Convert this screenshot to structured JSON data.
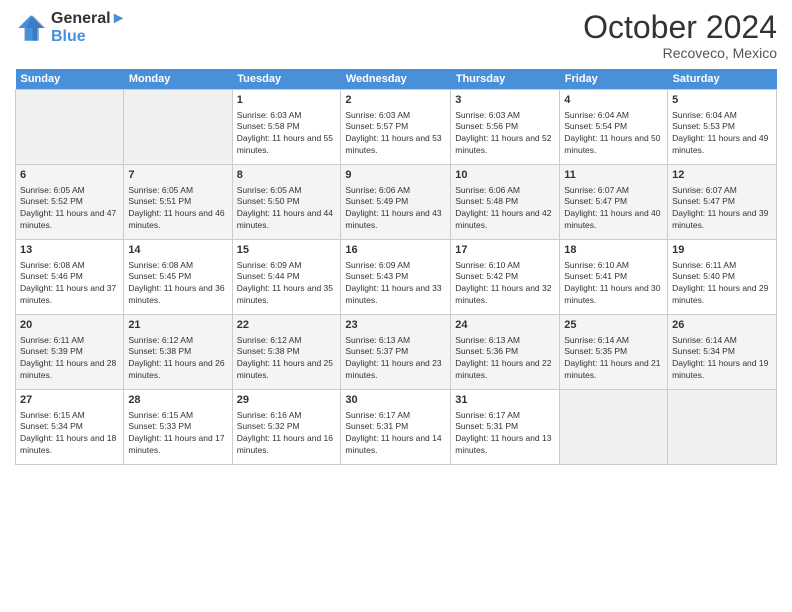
{
  "header": {
    "logo_line1": "General",
    "logo_line2": "Blue",
    "month": "October 2024",
    "location": "Recoveco, Mexico"
  },
  "weekdays": [
    "Sunday",
    "Monday",
    "Tuesday",
    "Wednesday",
    "Thursday",
    "Friday",
    "Saturday"
  ],
  "weeks": [
    [
      {
        "day": "",
        "data": ""
      },
      {
        "day": "",
        "data": ""
      },
      {
        "day": "1",
        "data": "Sunrise: 6:03 AM\nSunset: 5:58 PM\nDaylight: 11 hours and 55 minutes."
      },
      {
        "day": "2",
        "data": "Sunrise: 6:03 AM\nSunset: 5:57 PM\nDaylight: 11 hours and 53 minutes."
      },
      {
        "day": "3",
        "data": "Sunrise: 6:03 AM\nSunset: 5:56 PM\nDaylight: 11 hours and 52 minutes."
      },
      {
        "day": "4",
        "data": "Sunrise: 6:04 AM\nSunset: 5:54 PM\nDaylight: 11 hours and 50 minutes."
      },
      {
        "day": "5",
        "data": "Sunrise: 6:04 AM\nSunset: 5:53 PM\nDaylight: 11 hours and 49 minutes."
      }
    ],
    [
      {
        "day": "6",
        "data": "Sunrise: 6:05 AM\nSunset: 5:52 PM\nDaylight: 11 hours and 47 minutes."
      },
      {
        "day": "7",
        "data": "Sunrise: 6:05 AM\nSunset: 5:51 PM\nDaylight: 11 hours and 46 minutes."
      },
      {
        "day": "8",
        "data": "Sunrise: 6:05 AM\nSunset: 5:50 PM\nDaylight: 11 hours and 44 minutes."
      },
      {
        "day": "9",
        "data": "Sunrise: 6:06 AM\nSunset: 5:49 PM\nDaylight: 11 hours and 43 minutes."
      },
      {
        "day": "10",
        "data": "Sunrise: 6:06 AM\nSunset: 5:48 PM\nDaylight: 11 hours and 42 minutes."
      },
      {
        "day": "11",
        "data": "Sunrise: 6:07 AM\nSunset: 5:47 PM\nDaylight: 11 hours and 40 minutes."
      },
      {
        "day": "12",
        "data": "Sunrise: 6:07 AM\nSunset: 5:47 PM\nDaylight: 11 hours and 39 minutes."
      }
    ],
    [
      {
        "day": "13",
        "data": "Sunrise: 6:08 AM\nSunset: 5:46 PM\nDaylight: 11 hours and 37 minutes."
      },
      {
        "day": "14",
        "data": "Sunrise: 6:08 AM\nSunset: 5:45 PM\nDaylight: 11 hours and 36 minutes."
      },
      {
        "day": "15",
        "data": "Sunrise: 6:09 AM\nSunset: 5:44 PM\nDaylight: 11 hours and 35 minutes."
      },
      {
        "day": "16",
        "data": "Sunrise: 6:09 AM\nSunset: 5:43 PM\nDaylight: 11 hours and 33 minutes."
      },
      {
        "day": "17",
        "data": "Sunrise: 6:10 AM\nSunset: 5:42 PM\nDaylight: 11 hours and 32 minutes."
      },
      {
        "day": "18",
        "data": "Sunrise: 6:10 AM\nSunset: 5:41 PM\nDaylight: 11 hours and 30 minutes."
      },
      {
        "day": "19",
        "data": "Sunrise: 6:11 AM\nSunset: 5:40 PM\nDaylight: 11 hours and 29 minutes."
      }
    ],
    [
      {
        "day": "20",
        "data": "Sunrise: 6:11 AM\nSunset: 5:39 PM\nDaylight: 11 hours and 28 minutes."
      },
      {
        "day": "21",
        "data": "Sunrise: 6:12 AM\nSunset: 5:38 PM\nDaylight: 11 hours and 26 minutes."
      },
      {
        "day": "22",
        "data": "Sunrise: 6:12 AM\nSunset: 5:38 PM\nDaylight: 11 hours and 25 minutes."
      },
      {
        "day": "23",
        "data": "Sunrise: 6:13 AM\nSunset: 5:37 PM\nDaylight: 11 hours and 23 minutes."
      },
      {
        "day": "24",
        "data": "Sunrise: 6:13 AM\nSunset: 5:36 PM\nDaylight: 11 hours and 22 minutes."
      },
      {
        "day": "25",
        "data": "Sunrise: 6:14 AM\nSunset: 5:35 PM\nDaylight: 11 hours and 21 minutes."
      },
      {
        "day": "26",
        "data": "Sunrise: 6:14 AM\nSunset: 5:34 PM\nDaylight: 11 hours and 19 minutes."
      }
    ],
    [
      {
        "day": "27",
        "data": "Sunrise: 6:15 AM\nSunset: 5:34 PM\nDaylight: 11 hours and 18 minutes."
      },
      {
        "day": "28",
        "data": "Sunrise: 6:15 AM\nSunset: 5:33 PM\nDaylight: 11 hours and 17 minutes."
      },
      {
        "day": "29",
        "data": "Sunrise: 6:16 AM\nSunset: 5:32 PM\nDaylight: 11 hours and 16 minutes."
      },
      {
        "day": "30",
        "data": "Sunrise: 6:17 AM\nSunset: 5:31 PM\nDaylight: 11 hours and 14 minutes."
      },
      {
        "day": "31",
        "data": "Sunrise: 6:17 AM\nSunset: 5:31 PM\nDaylight: 11 hours and 13 minutes."
      },
      {
        "day": "",
        "data": ""
      },
      {
        "day": "",
        "data": ""
      }
    ]
  ]
}
